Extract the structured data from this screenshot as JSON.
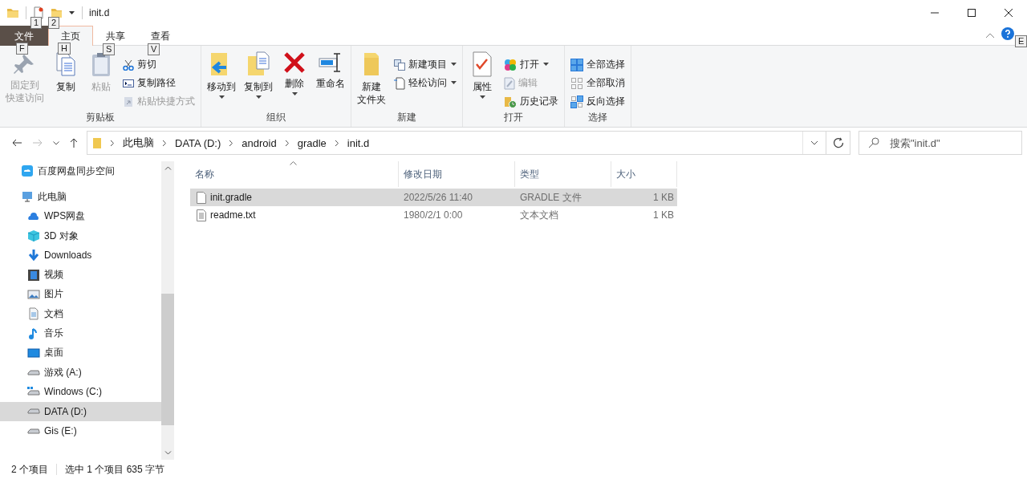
{
  "window": {
    "title": "init.d",
    "quick_access": [
      {
        "keytip": "1"
      },
      {
        "keytip": "2"
      }
    ]
  },
  "tabs": [
    {
      "label": "文件",
      "kind": "file",
      "selected": false,
      "keytip": "F"
    },
    {
      "label": "主页",
      "kind": "normal",
      "selected": true,
      "keytip": "H"
    },
    {
      "label": "共享",
      "kind": "normal",
      "selected": false,
      "keytip": "S"
    },
    {
      "label": "查看",
      "kind": "normal",
      "selected": false,
      "keytip": "V"
    }
  ],
  "help": {
    "keytip": "E"
  },
  "ribbon": [
    {
      "label": "剪贴板",
      "commands": [
        {
          "label": [
            "固定到",
            "快速访问"
          ],
          "kind": "big",
          "disabled": true,
          "dropdown": false
        },
        {
          "label": "复制",
          "kind": "big",
          "disabled": false,
          "dropdown": false
        },
        {
          "label": "粘贴",
          "kind": "big",
          "disabled": true,
          "dropdown": false
        },
        {
          "label": "剪切",
          "kind": "small",
          "disabled": false,
          "dropdown": false
        },
        {
          "label": "复制路径",
          "kind": "small",
          "disabled": false,
          "dropdown": false
        },
        {
          "label": "粘贴快捷方式",
          "kind": "small",
          "disabled": true,
          "dropdown": false
        }
      ]
    },
    {
      "label": "组织",
      "commands": [
        {
          "label": "移动到",
          "kind": "big",
          "disabled": false,
          "dropdown": true
        },
        {
          "label": "复制到",
          "kind": "big",
          "disabled": false,
          "dropdown": true
        },
        {
          "label": "删除",
          "kind": "big",
          "disabled": false,
          "dropdown": true
        },
        {
          "label": "重命名",
          "kind": "big",
          "disabled": false,
          "dropdown": false
        }
      ]
    },
    {
      "label": "新建",
      "commands": [
        {
          "label": [
            "新建",
            "文件夹"
          ],
          "kind": "big",
          "disabled": false,
          "dropdown": false
        },
        {
          "label": "新建项目",
          "kind": "small",
          "disabled": false,
          "dropdown": true
        },
        {
          "label": "轻松访问",
          "kind": "small",
          "disabled": false,
          "dropdown": true
        }
      ]
    },
    {
      "label": "打开",
      "commands": [
        {
          "label": "属性",
          "kind": "big",
          "disabled": false,
          "dropdown": true
        },
        {
          "label": "打开",
          "kind": "small",
          "disabled": false,
          "dropdown": true
        },
        {
          "label": "编辑",
          "kind": "small",
          "disabled": true,
          "dropdown": false
        },
        {
          "label": "历史记录",
          "kind": "small",
          "disabled": false,
          "dropdown": false
        }
      ]
    },
    {
      "label": "选择",
      "commands": [
        {
          "label": "全部选择",
          "kind": "small",
          "disabled": false,
          "dropdown": false
        },
        {
          "label": "全部取消",
          "kind": "small",
          "disabled": false,
          "dropdown": false
        },
        {
          "label": "反向选择",
          "kind": "small",
          "disabled": false,
          "dropdown": false
        }
      ]
    }
  ],
  "address": {
    "path": [
      "此电脑",
      "DATA (D:)",
      "android",
      "gradle",
      "init.d"
    ],
    "search": {
      "placeholder": "搜索\"init.d\""
    }
  },
  "sidebar": {
    "items": [
      {
        "label": "百度网盘同步空间",
        "selected": false
      },
      {
        "label": "此电脑",
        "selected": false,
        "children": [
          {
            "label": "WPS网盘",
            "selected": false
          },
          {
            "label": "3D 对象",
            "selected": false
          },
          {
            "label": "Downloads",
            "selected": false
          },
          {
            "label": "视频",
            "selected": false
          },
          {
            "label": "图片",
            "selected": false
          },
          {
            "label": "文档",
            "selected": false
          },
          {
            "label": "音乐",
            "selected": false
          },
          {
            "label": "桌面",
            "selected": false
          },
          {
            "label": "游戏 (A:)",
            "selected": false
          },
          {
            "label": "Windows (C:)",
            "selected": false
          },
          {
            "label": "DATA (D:)",
            "selected": true
          },
          {
            "label": "Gis (E:)",
            "selected": false
          }
        ]
      }
    ]
  },
  "table": {
    "columns": [
      "名称",
      "修改日期",
      "类型",
      "大小"
    ],
    "rows": [
      {
        "cells": [
          "init.gradle",
          "2022/5/26 11:40",
          "GRADLE 文件",
          "1 KB"
        ],
        "selected": true
      },
      {
        "cells": [
          "readme.txt",
          "1980/2/1 0:00",
          "文本文档",
          "1 KB"
        ],
        "selected": false
      }
    ]
  },
  "status_bar": {
    "count": "2 个项目",
    "selection": "选中 1 个项目  635 字节"
  }
}
